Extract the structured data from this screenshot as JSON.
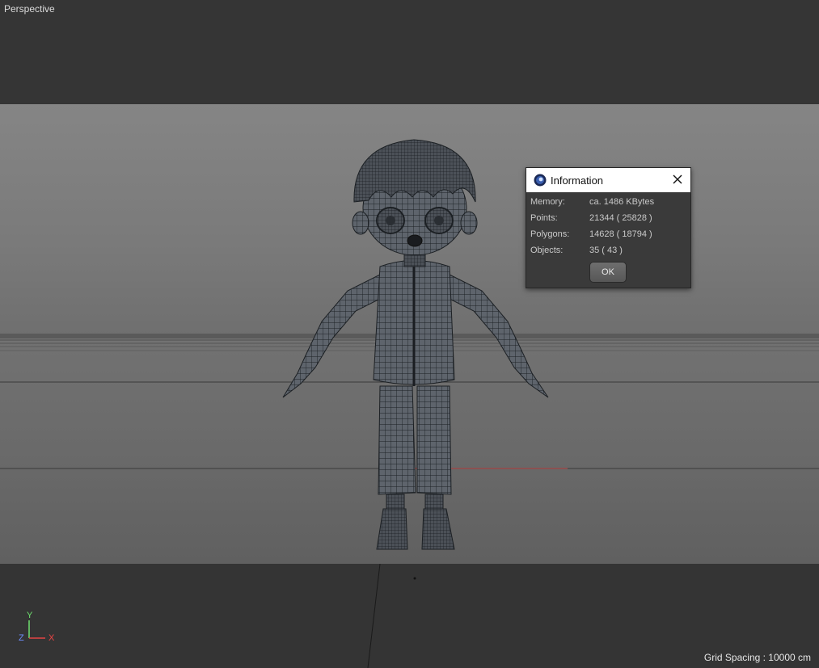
{
  "viewport": {
    "label": "Perspective",
    "grid_spacing": "Grid Spacing : 10000 cm",
    "axis": {
      "y": "Y",
      "z": "Z",
      "x": "X"
    }
  },
  "info_dialog": {
    "title": "Information",
    "rows": [
      {
        "label": "Memory:",
        "value": "ca. 1486 KBytes"
      },
      {
        "label": "Points:",
        "value": "21344 ( 25828 )"
      },
      {
        "label": "Polygons:",
        "value": "14628 ( 18794 )"
      },
      {
        "label": "Objects:",
        "value": "35 ( 43 )"
      }
    ],
    "ok_label": "OK"
  },
  "colors": {
    "axis_x": "#e44444",
    "axis_y": "#6fe06f",
    "axis_z": "#6f8fff",
    "wire": "#1e2226",
    "mesh": "#5a6068"
  },
  "icons": [
    "cinema4d-logo-icon",
    "close-icon"
  ]
}
